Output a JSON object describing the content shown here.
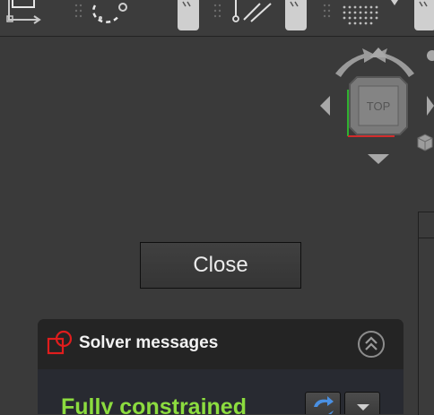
{
  "toolbar": {
    "groups": [
      {
        "id": "constrain-lock",
        "icon": "lock-constraint-icon"
      },
      {
        "id": "constrain-radius",
        "icon": "radius-arc-icon"
      },
      {
        "id": "overflow-1",
        "icon": "overflow-chevron-icon"
      },
      {
        "id": "construction-lines",
        "icon": "construction-line-icon"
      },
      {
        "id": "overflow-2",
        "icon": "overflow-chevron-icon"
      },
      {
        "id": "grid-snap",
        "icon": "grid-snap-icon"
      },
      {
        "id": "overflow-3",
        "icon": "overflow-chevron-icon"
      }
    ]
  },
  "navigation_cube": {
    "face_label": "TOP",
    "icons": [
      "rotate-left-arrow-icon",
      "rotate-right-arrow-icon",
      "nav-up-arrow-icon",
      "nav-down-arrow-icon",
      "nav-left-arrow-icon",
      "nav-right-arrow-icon",
      "view-menu-cube-icon"
    ]
  },
  "close_button": {
    "label": "Close"
  },
  "solver_panel": {
    "title": "Solver messages",
    "status": "Fully constrained",
    "status_color": "#8cdc3f",
    "icons": {
      "title": "sketcher-constraint-icon",
      "collapse": "collapse-chevrons-icon",
      "refresh": "refresh-icon",
      "menu": "dropdown-arrow-icon"
    }
  },
  "colors": {
    "background": "#3a3a3a",
    "panel_header": "#242424",
    "panel_body": "#282a31",
    "x_axis": "#d22b2b",
    "y_axis": "#2fb12f"
  }
}
